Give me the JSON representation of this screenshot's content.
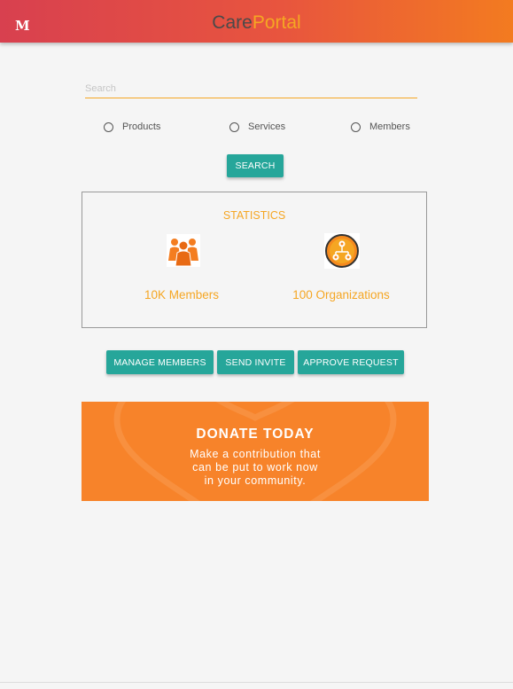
{
  "header": {
    "logo_letter": "M",
    "brand_part1": "Care",
    "brand_part2": "Portal",
    "brand_color": "#f5a623",
    "gradient": [
      "#d8404f",
      "#f37b20"
    ]
  },
  "search": {
    "placeholder": "Search",
    "value": "",
    "options": [
      {
        "label": "Products",
        "selected": false
      },
      {
        "label": "Services",
        "selected": false
      },
      {
        "label": "Members",
        "selected": false
      }
    ],
    "button_label": "SEARCH"
  },
  "statistics": {
    "title": "STATISTICS",
    "items": [
      {
        "icon": "members-group-icon",
        "label": "10K Members"
      },
      {
        "icon": "organizations-network-icon",
        "label": "100 Organizations"
      }
    ]
  },
  "actions": [
    {
      "label": "MANAGE MEMBERS"
    },
    {
      "label": "SEND INVITE"
    },
    {
      "label": "APPROVE REQUEST"
    }
  ],
  "donate": {
    "title": "DONATE TODAY",
    "text": "Make a contribution that\ncan be put to work now\nin your community.",
    "color": "#f7832a"
  },
  "colors": {
    "accent": "#f5a623",
    "button": "#26a69a",
    "background": "#f5f5f5"
  }
}
